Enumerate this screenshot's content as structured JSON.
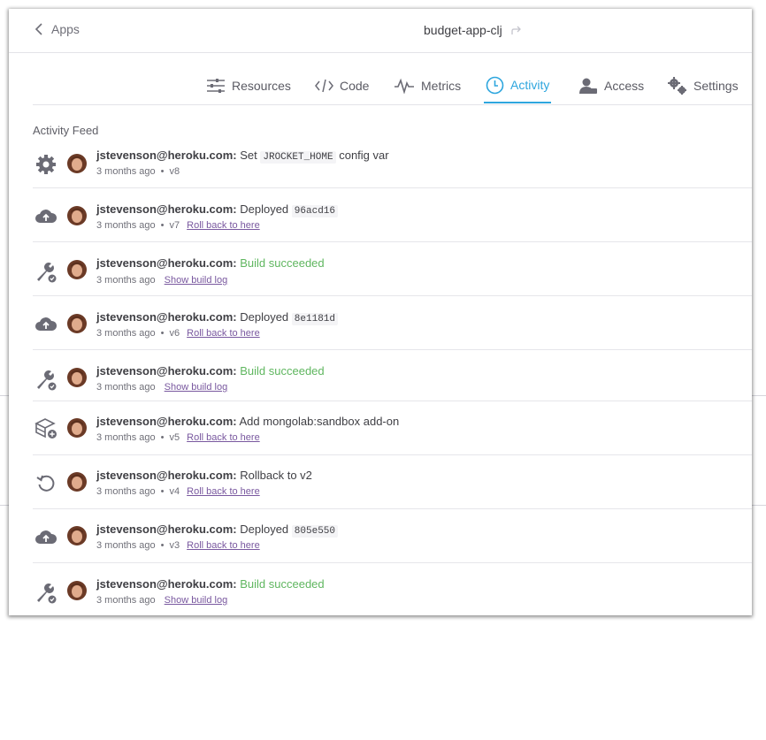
{
  "header": {
    "back_label": "Apps",
    "app_name": "budget-app-clj"
  },
  "tabs": [
    {
      "label": "Resources",
      "icon": "resources-icon",
      "active": false
    },
    {
      "label": "Code",
      "icon": "code-icon",
      "active": false
    },
    {
      "label": "Metrics",
      "icon": "metrics-icon",
      "active": false
    },
    {
      "label": "Activity",
      "icon": "clock-icon",
      "active": true
    },
    {
      "label": "Access",
      "icon": "user-icon",
      "active": false
    },
    {
      "label": "Settings",
      "icon": "gears-icon",
      "active": false
    }
  ],
  "feed": {
    "title": "Activity Feed",
    "items": [
      {
        "icon": "gear-icon",
        "user": "jstevenson@heroku.com:",
        "text": "Set",
        "code": "JROCKET_HOME",
        "text2": "config var",
        "time": "3 months ago",
        "version": "v8",
        "link": ""
      },
      {
        "icon": "cloud-upload-icon",
        "user": "jstevenson@heroku.com:",
        "text": "Deployed",
        "code": "96acd16",
        "time": "3 months ago",
        "version": "v7",
        "link": "Roll back to here"
      },
      {
        "icon": "wrench-check-icon",
        "user": "jstevenson@heroku.com:",
        "success": "Build succeeded",
        "time": "3 months ago",
        "link": "Show build log"
      },
      {
        "icon": "cloud-upload-icon",
        "user": "jstevenson@heroku.com:",
        "text": "Deployed",
        "code": "8e1181d",
        "time": "3 months ago",
        "version": "v6",
        "link": "Roll back to here"
      },
      {
        "icon": "wrench-check-icon",
        "user": "jstevenson@heroku.com:",
        "success": "Build succeeded",
        "time": "3 months ago",
        "link": "Show build log"
      },
      {
        "icon": "addon-icon",
        "user": "jstevenson@heroku.com:",
        "text": "Add mongolab:sandbox add-on",
        "time": "3 months ago",
        "version": "v5",
        "link": "Roll back to here"
      },
      {
        "icon": "rollback-icon",
        "user": "jstevenson@heroku.com:",
        "text": "Rollback to v2",
        "time": "3 months ago",
        "version": "v4",
        "link": "Roll back to here"
      },
      {
        "icon": "cloud-upload-icon",
        "user": "jstevenson@heroku.com:",
        "text": "Deployed",
        "code": "805e550",
        "time": "3 months ago",
        "version": "v3",
        "link": "Roll back to here"
      },
      {
        "icon": "wrench-check-icon",
        "user": "jstevenson@heroku.com:",
        "success": "Build succeeded",
        "time": "3 months ago",
        "link": "Show build log"
      }
    ]
  },
  "colors": {
    "accent": "#2ea6de",
    "success": "#5fb65f",
    "link": "#79589f"
  }
}
